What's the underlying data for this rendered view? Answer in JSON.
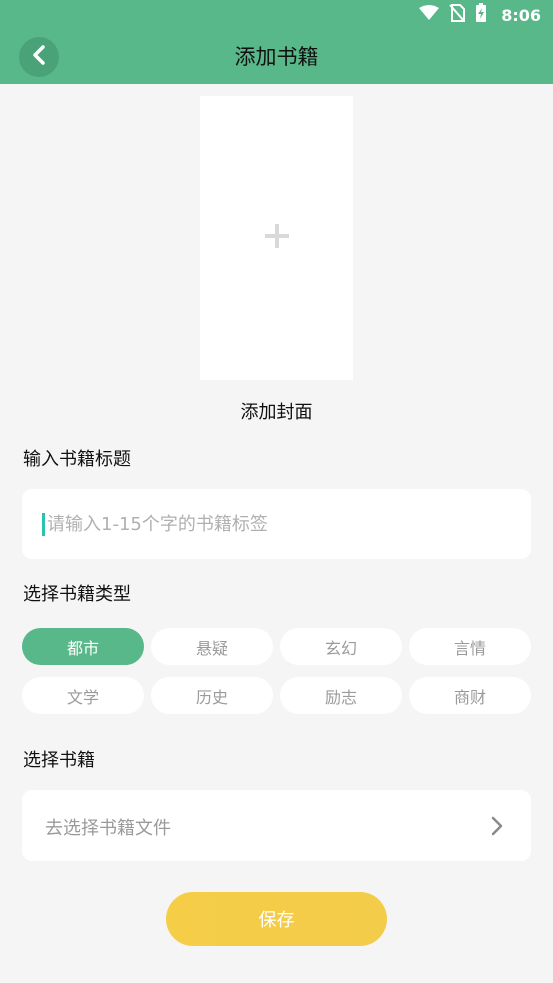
{
  "status_bar": {
    "time": "8:06",
    "icons": [
      "wifi-icon",
      "no-sim-icon",
      "battery-charging-icon"
    ]
  },
  "header": {
    "title": "添加书籍",
    "back_icon": "chevron-left-icon"
  },
  "cover": {
    "add_icon": "plus-icon",
    "label": "添加封面"
  },
  "title_section": {
    "label": "输入书籍标题",
    "input_placeholder": "请输入1-15个字的书籍标签",
    "input_value": ""
  },
  "type_section": {
    "label": "选择书籍类型",
    "selected": "都市",
    "types": [
      "都市",
      "悬疑",
      "玄幻",
      "言情",
      "文学",
      "历史",
      "励志",
      "商财"
    ]
  },
  "file_section": {
    "label": "选择书籍",
    "select_text": "去选择书籍文件",
    "arrow_icon": "chevron-right-icon"
  },
  "save_button": {
    "label": "保存"
  },
  "colors": {
    "header_bg": "#58b88a",
    "accent": "#58b88a",
    "save_button": "#f5cd47",
    "page_bg": "#f5f5f5"
  }
}
